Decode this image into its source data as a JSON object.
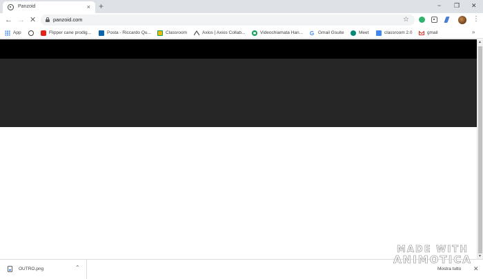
{
  "tab": {
    "title": "Panzoid",
    "close_icon": "×"
  },
  "tabstrip": {
    "new_tab_icon": "+",
    "minimize_icon": "−",
    "restore_icon": "❐",
    "close_icon": "✕"
  },
  "toolbar": {
    "back_icon": "←",
    "forward_icon": "→",
    "stop_icon": "✕",
    "url": "panzoid.com",
    "star_icon": "☆",
    "menu_icon": "⋮"
  },
  "bookmarks": {
    "items": [
      {
        "label": "App",
        "icon": "apps-icon"
      },
      {
        "label": "",
        "icon": "globe-icon"
      },
      {
        "label": "Flipper cane prodig...",
        "icon": "youtube-icon"
      },
      {
        "label": "Posta - Riccardo Qu...",
        "icon": "outlook-icon"
      },
      {
        "label": "Classroom",
        "icon": "classroom-icon"
      },
      {
        "label": "Axios | Axios Collab...",
        "icon": "axios-icon"
      },
      {
        "label": "Videochiamata Han...",
        "icon": "hangouts-icon"
      },
      {
        "label": "Gmail Gsuite",
        "icon": "google-icon"
      },
      {
        "label": "Meet",
        "icon": "meet-icon"
      },
      {
        "label": "classroom 2.0",
        "icon": "classroom2-icon"
      },
      {
        "label": "gmail",
        "icon": "gmail-icon"
      }
    ],
    "more_icon": "»"
  },
  "scrollbar": {
    "up_icon": "▲",
    "down_icon": "▼"
  },
  "downloads": {
    "file_name": "OUTRO.png",
    "chevron_icon": "⌃",
    "show_all_label": "Mostra tutto",
    "close_icon": "✕"
  },
  "watermark": {
    "line1": "MADE WITH",
    "line2": "ANIMOTICA"
  },
  "colors": {
    "site_header": "#000000",
    "site_hero": "#262626",
    "tabstrip": "#dee1e6"
  }
}
